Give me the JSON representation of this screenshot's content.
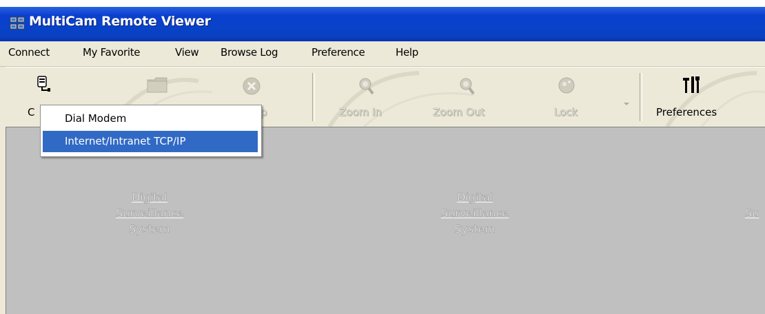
{
  "window": {
    "title": "MultiCam Remote Viewer"
  },
  "menu": [
    "Connect",
    "My Favorite",
    "View",
    "Browse Log",
    "Preference",
    "Help"
  ],
  "toolbar": {
    "connect_label_visible": "C",
    "setup_label_visible": "p",
    "zoom_in": "Zoom In",
    "zoom_out": "Zoom Out",
    "lock": "Lock",
    "preferences": "Preferences"
  },
  "dropdown": {
    "items": [
      "Dial Modem",
      "Internet/Intranet TCP/IP"
    ],
    "selected": "Internet/Intranet TCP/IP"
  },
  "panels": [
    {
      "line1": "Digital",
      "line2": "Surveillance",
      "line3": "System"
    },
    {
      "line1": "Digital",
      "line2": "Surveillance",
      "line3": "System"
    },
    {
      "line2": "Su"
    }
  ],
  "colors": {
    "titlebar": "#0a3fd0",
    "selection": "#316ac5",
    "content": "#c0c0c0"
  }
}
